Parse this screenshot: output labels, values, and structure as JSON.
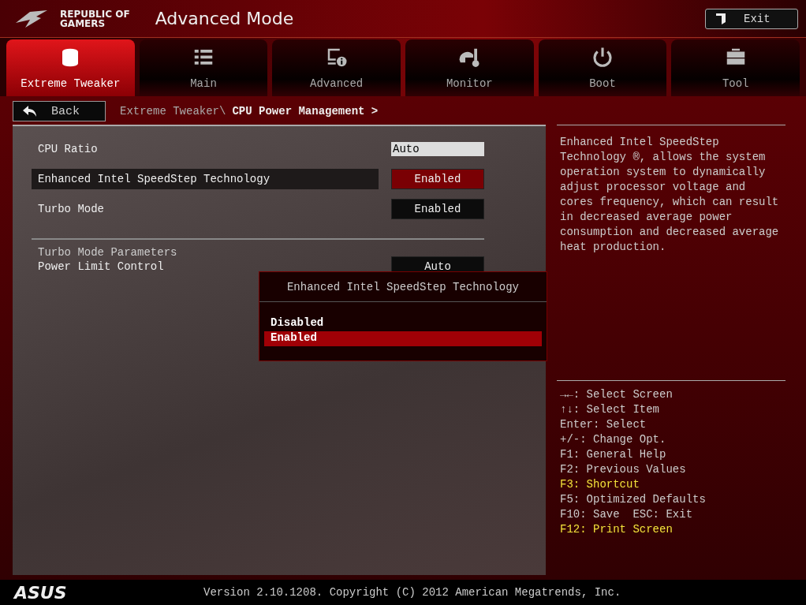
{
  "header": {
    "brand_line_1": "REPUBLIC OF",
    "brand_line_2": "GAMERS",
    "title": "Advanced Mode",
    "exit_button": "Exit"
  },
  "tabs": [
    {
      "label": "Extreme Tweaker",
      "kind": "tweaker",
      "selected": true
    },
    {
      "label": "Main",
      "kind": "list",
      "selected": false
    },
    {
      "label": "Advanced",
      "kind": "info",
      "selected": false
    },
    {
      "label": "Monitor",
      "kind": "gauge",
      "selected": false
    },
    {
      "label": "Boot",
      "kind": "power",
      "selected": false
    },
    {
      "label": "Tool",
      "kind": "toolbox",
      "selected": false
    }
  ],
  "back_button": "Back",
  "breadcrumb": {
    "parent": "Extreme Tweaker\\",
    "current": "CPU Power Management >"
  },
  "settings": [
    {
      "kind": "field",
      "label": "CPU Ratio",
      "value": "Auto",
      "selected": false
    },
    {
      "kind": "option",
      "label": "Enhanced Intel SpeedStep Technology",
      "value": "Enabled",
      "selected": true
    },
    {
      "kind": "option",
      "label": "Turbo Mode",
      "value": "Enabled",
      "selected": false
    },
    {
      "kind": "heading",
      "label": "Turbo Mode Parameters"
    },
    {
      "kind": "option",
      "label": "Power Limit Control",
      "value": "Auto",
      "selected": false
    }
  ],
  "popup": {
    "title": "Enhanced Intel SpeedStep Technology",
    "options": [
      {
        "label": "Disabled",
        "selected": false
      },
      {
        "label": "Enabled",
        "selected": true
      }
    ]
  },
  "help_text": "Enhanced Intel SpeedStep Technology ®, allows the system operation system to dynamically adjust processor voltage and cores frequency, which can result in decreased average power consumption and decreased average heat production.",
  "key_hints": [
    {
      "text": "→←: Select Screen",
      "highlight": false
    },
    {
      "text": "↑↓: Select Item",
      "highlight": false
    },
    {
      "text": "Enter: Select",
      "highlight": false
    },
    {
      "text": "+/-: Change Opt.",
      "highlight": false
    },
    {
      "text": "F1: General Help",
      "highlight": false
    },
    {
      "text": "F2: Previous Values",
      "highlight": false
    },
    {
      "text": "F3: Shortcut",
      "highlight": true
    },
    {
      "text": "F5: Optimized Defaults",
      "highlight": false
    },
    {
      "text": "F10: Save  ESC: Exit",
      "highlight": false
    },
    {
      "text": "F12: Print Screen",
      "highlight": true
    }
  ],
  "footer": {
    "logo": "ASUS",
    "version": "Version 2.10.1208. Copyright (C) 2012 American Megatrends, Inc."
  }
}
